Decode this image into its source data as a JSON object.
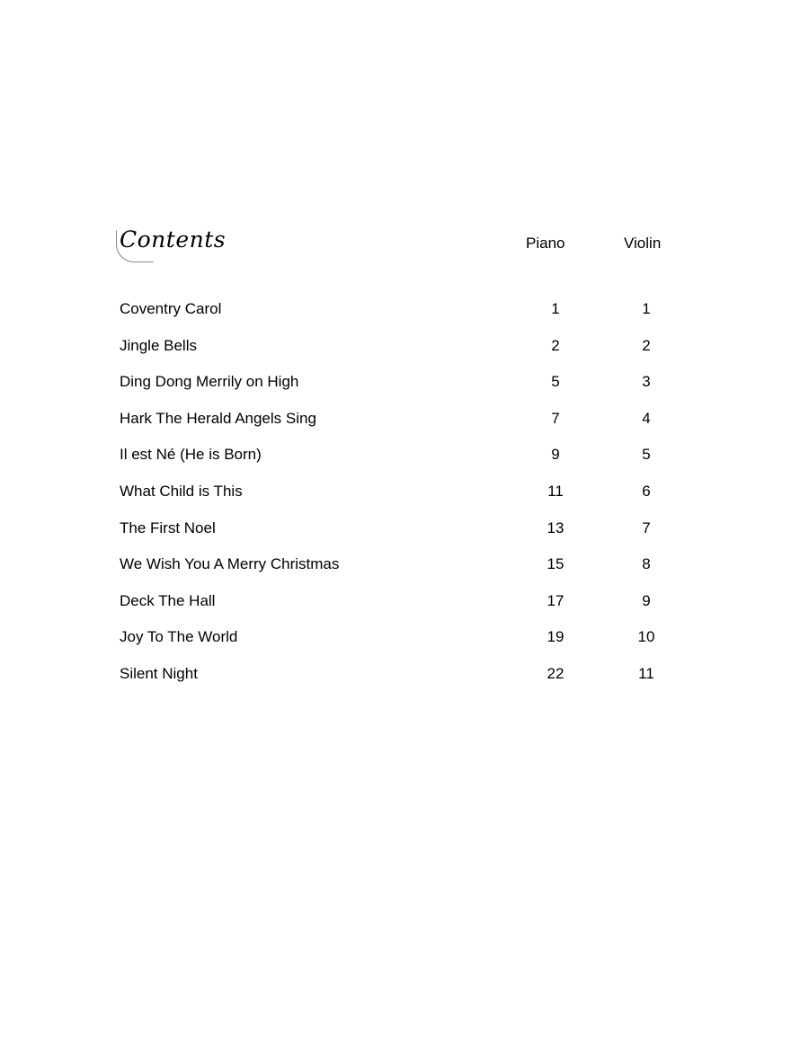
{
  "heading": "Contents",
  "columns": {
    "piano": "Piano",
    "violin": "Violin"
  },
  "entries": [
    {
      "title": "Coventry Carol",
      "piano": "1",
      "violin": "1"
    },
    {
      "title": "Jingle Bells",
      "piano": "2",
      "violin": "2"
    },
    {
      "title": "Ding Dong Merrily on High",
      "piano": "5",
      "violin": "3"
    },
    {
      "title": "Hark The Herald Angels Sing",
      "piano": "7",
      "violin": "4"
    },
    {
      "title": "Il est Né (He is Born)",
      "piano": "9",
      "violin": "5"
    },
    {
      "title": "What Child is This",
      "piano": "11",
      "violin": "6"
    },
    {
      "title": "The First Noel",
      "piano": "13",
      "violin": "7"
    },
    {
      "title": "We Wish You A Merry Christmas",
      "piano": "15",
      "violin": "8"
    },
    {
      "title": "Deck The Hall",
      "piano": "17",
      "violin": "9"
    },
    {
      "title": "Joy To The World",
      "piano": "19",
      "violin": "10"
    },
    {
      "title": "Silent Night",
      "piano": "22",
      "violin": "11"
    }
  ]
}
